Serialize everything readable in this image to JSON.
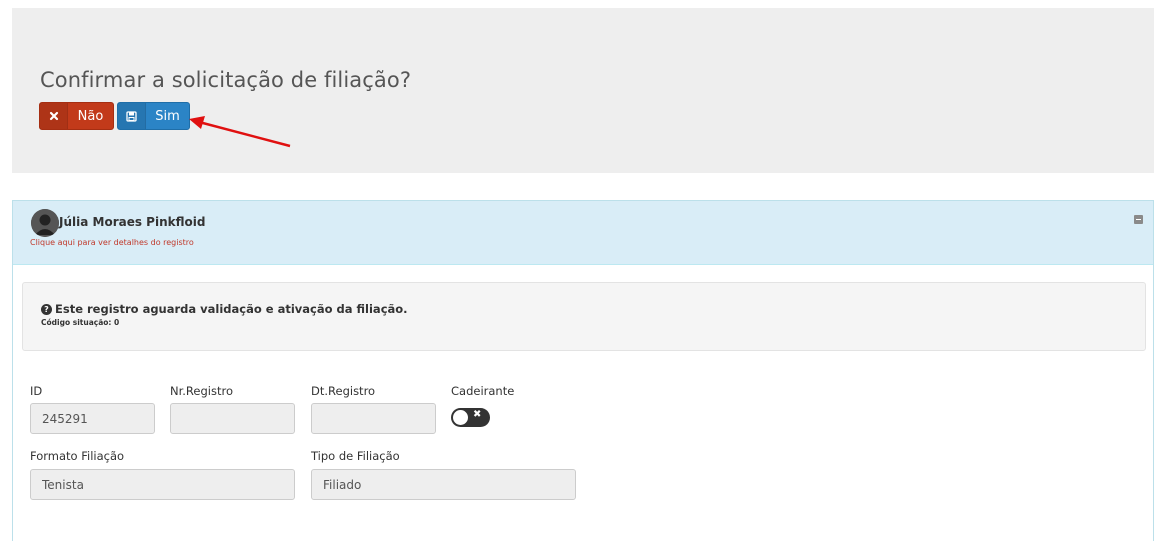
{
  "confirm": {
    "title": "Confirmar a solicitação de filiação?",
    "no_label": "Não",
    "yes_label": "Sim"
  },
  "record": {
    "name": "Júlia Moraes Pinkfloid",
    "details_link": "Clique aqui para ver detalhes do registro",
    "status_message": "Este registro aguarda validação e ativação da filiação.",
    "status_code": "Código situação: 0"
  },
  "fields": {
    "id_label": "ID",
    "id_value": "245291",
    "nr_registro_label": "Nr.Registro",
    "nr_registro_value": "",
    "dt_registro_label": "Dt.Registro",
    "dt_registro_value": "",
    "cadeirante_label": "Cadeirante",
    "cadeirante_on": false,
    "formato_label": "Formato Filiação",
    "formato_value": "Tenista",
    "tipo_label": "Tipo de Filiação",
    "tipo_value": "Filiado"
  },
  "colors": {
    "no_button": "#c23a1a",
    "yes_button": "#2b84c6",
    "annotation_arrow": "#e01010",
    "header_bg": "#d9edf7"
  },
  "icons": [
    "close-icon",
    "save-icon",
    "question-circle-icon",
    "collapse-icon",
    "user-avatar"
  ]
}
